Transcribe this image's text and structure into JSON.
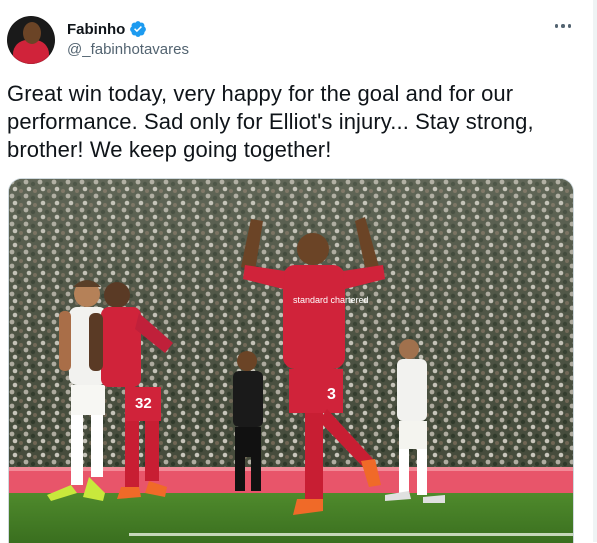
{
  "author": {
    "display_name": "Fabinho",
    "handle": "@_fabinhotavares",
    "verified": true,
    "verified_icon": "verified-badge-icon",
    "verified_color": "#1d9bf0"
  },
  "tweet": {
    "text": "Great win today, very happy for the goal and for our performance. Sad only for Elliot's injury... Stay strong, brother! We keep going together!"
  },
  "media": {
    "description_kind": "photo",
    "shirt_sponsor": "standard chartered",
    "player_numbers": [
      "32",
      "3"
    ]
  },
  "actions": {
    "more_icon": "more-horizontal-icon"
  }
}
